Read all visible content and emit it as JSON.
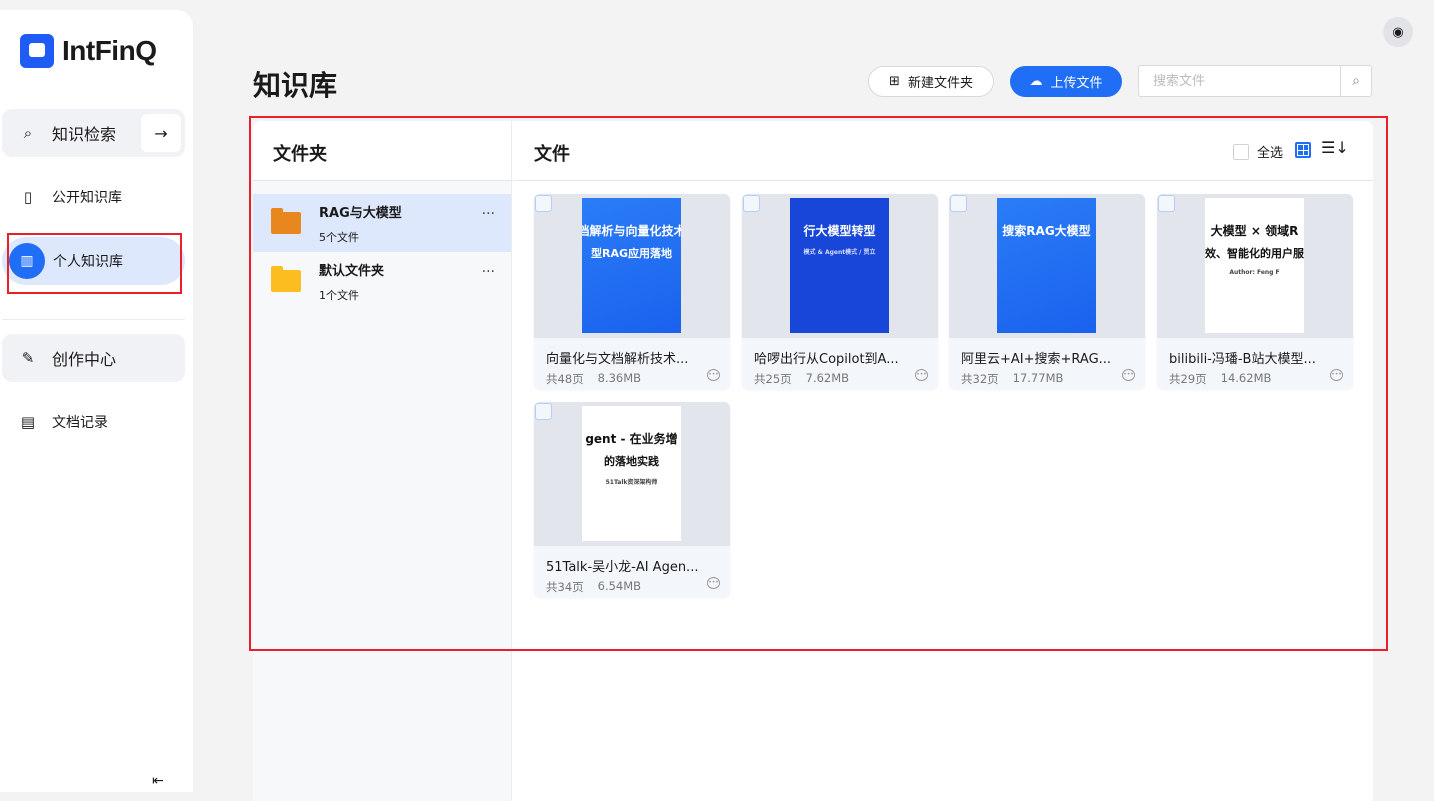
{
  "brand": {
    "name": "IntFinQ",
    "accent": "#1f6ef5"
  },
  "sidebar": {
    "items": [
      {
        "label": "知识检索",
        "icon": "search-icon"
      },
      {
        "label": "公开知识库",
        "icon": "book-icon"
      },
      {
        "label": "个人知识库",
        "icon": "library-icon"
      },
      {
        "label": "创作中心",
        "icon": "edit-icon"
      },
      {
        "label": "文档记录",
        "icon": "document-search-icon"
      }
    ],
    "search_arrow": "→",
    "collapse": "⇤"
  },
  "header": {
    "title": "知识库",
    "new_folder": "新建文件夹",
    "upload": "上传文件",
    "search_placeholder": "搜索文件"
  },
  "folders": {
    "title": "文件夹",
    "items": [
      {
        "name": "RAG与大模型",
        "count": "5个文件",
        "color": "#e8871e"
      },
      {
        "name": "默认文件夹",
        "count": "1个文件",
        "color": "#fbbd1f"
      }
    ]
  },
  "files": {
    "title": "文件",
    "select_all": "全选",
    "items": [
      {
        "name": "向量化与文档解析技术...",
        "pages": "共48页",
        "size": "8.36MB",
        "cover": {
          "style": "blue",
          "l1": "档解析与向量化技术",
          "l2": "型RAG应用落地",
          "l3": ""
        }
      },
      {
        "name": "哈啰出行从Copilot到A...",
        "pages": "共25页",
        "size": "7.62MB",
        "cover": {
          "style": "dark",
          "l1": "行大模型转型",
          "l2": "",
          "l3": "模式 & Agent模式 / 贾立"
        }
      },
      {
        "name": "阿里云+AI+搜索+RAG...",
        "pages": "共32页",
        "size": "17.77MB",
        "cover": {
          "style": "blue",
          "l1": "搜索RAG大模型",
          "l2": "",
          "l3": ""
        }
      },
      {
        "name": "bilibili-冯璠-B站大模型...",
        "pages": "共29页",
        "size": "14.62MB",
        "cover": {
          "style": "white",
          "l1": "大模型 × 领域R",
          "l2": "效、智能化的用户服",
          "l3": "Author: Feng F"
        }
      },
      {
        "name": "51Talk-吴小龙-AI Agen...",
        "pages": "共34页",
        "size": "6.54MB",
        "cover": {
          "style": "white",
          "l1": "gent - 在业务增",
          "l2": "的落地实践",
          "l3": "51Talk资深架构师"
        }
      }
    ]
  }
}
